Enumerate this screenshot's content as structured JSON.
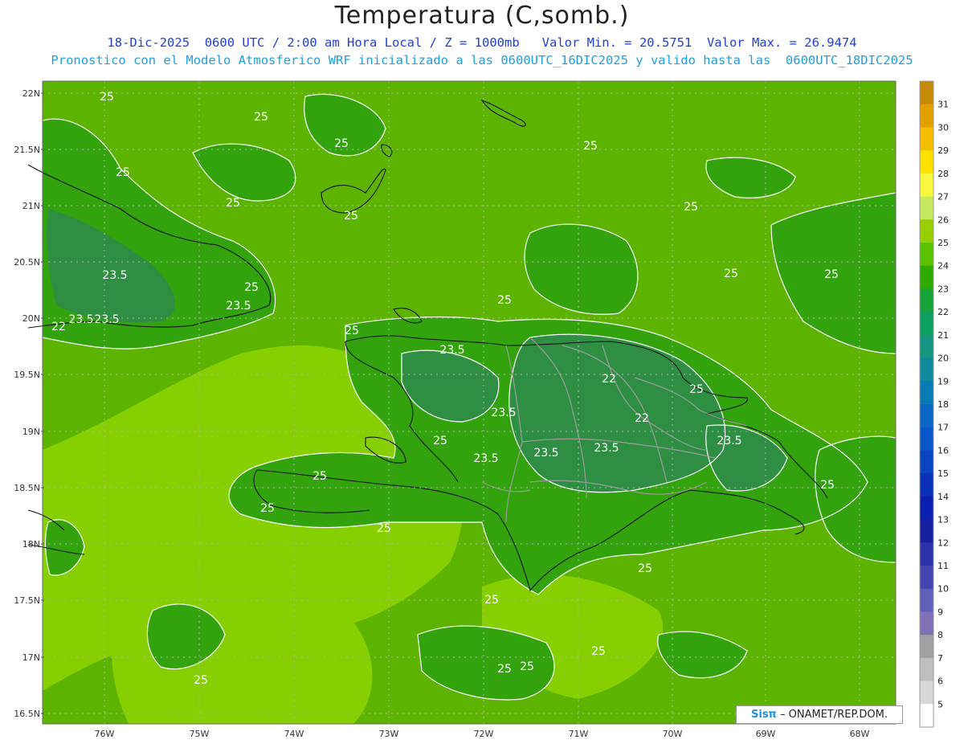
{
  "title": "Temperatura (C,somb.)",
  "subtitle_line1": "18-Dic-2025  0600 UTC / 2:00 am Hora Local / Z = 1000mb   Valor Min. = 20.5751  Valor Max. = 26.9474",
  "subtitle_line2": "Pronostico con el Modelo Atmosferico WRF inicializado a las 0600UTC_16DIC2025 y valido hasta las  0600UTC_18DIC2025",
  "brand": {
    "logo": "Sisπ",
    "text": " – ONAMET/REP.DOM."
  },
  "map": {
    "lat_labels": [
      "22N",
      "21.5N",
      "21N",
      "20.5N",
      "20N",
      "19.5N",
      "19N",
      "18.5N",
      "18N",
      "17.5N",
      "17N",
      "16.5N"
    ],
    "lon_labels": [
      "76W",
      "75W",
      "74W",
      "73W",
      "72W",
      "71W",
      "70W",
      "69W",
      "68W"
    ],
    "contour_labels": [
      "25",
      "25",
      "25",
      "25",
      "25",
      "25",
      "25",
      "25",
      "25",
      "23.5",
      "23.5",
      "23.5",
      "23.5",
      "22",
      "23.5",
      "25",
      "22",
      "23.5",
      "23.5",
      "23.5",
      "23.5",
      "23.5",
      "22",
      "25",
      "25",
      "25",
      "25",
      "25",
      "25",
      "25",
      "25",
      "25",
      "25",
      "25",
      "25",
      "25",
      "25",
      "25"
    ]
  },
  "colorbar": {
    "ticks": [
      "31",
      "30",
      "29",
      "28",
      "27",
      "26",
      "25",
      "24",
      "23",
      "22",
      "21",
      "20",
      "19",
      "18",
      "17",
      "16",
      "15",
      "14",
      "13",
      "12",
      "11",
      "10",
      "9",
      "8",
      "7",
      "6",
      "5"
    ],
    "colors": [
      "#c48a06",
      "#e2a000",
      "#f5be00",
      "#ffe000",
      "#f8f840",
      "#c8e860",
      "#96d000",
      "#5ac000",
      "#2eaa00",
      "#17a33a",
      "#0ca060",
      "#169680",
      "#0e8a9a",
      "#0a7ab2",
      "#0c66c4",
      "#0a56c8",
      "#0a44c0",
      "#0a30b8",
      "#0a1eb0",
      "#1420a0",
      "#2a34a8",
      "#4444b0",
      "#6060b8",
      "#8070b4",
      "#a0a0a0",
      "#bebebe",
      "#d8d8d8",
      "#ffffff"
    ],
    "fill_colors": {
      "base_25_26": "#5db400",
      "warm_26_27": "#86cf00",
      "cool_24_25": "#33a30d",
      "cold_22_23": "#2e8f42",
      "contour": "#ffffff"
    }
  }
}
